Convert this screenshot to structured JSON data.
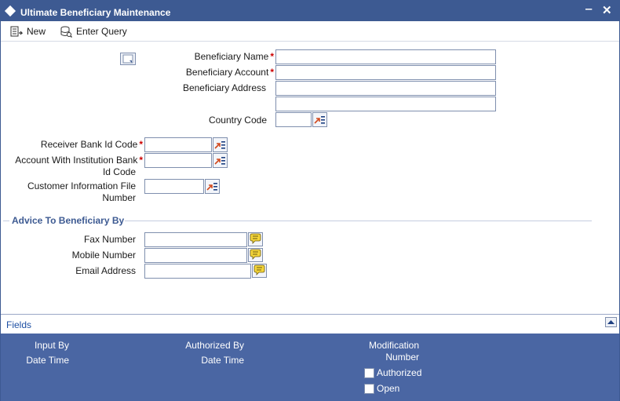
{
  "window": {
    "title": "Ultimate Beneficiary Maintenance",
    "minimize": "‒",
    "close": "✕"
  },
  "toolbar": {
    "new_label": "New",
    "enter_query_label": "Enter Query"
  },
  "form": {
    "beneficiary_name_label": "Beneficiary Name",
    "beneficiary_account_label": "Beneficiary Account",
    "beneficiary_address_label": "Beneficiary Address",
    "country_code_label": "Country Code",
    "receiver_bank_label": "Receiver Bank Id Code",
    "account_with_label_1": "Account With Institution Bank",
    "account_with_label_2": "Id Code",
    "cif_label_1": "Customer Information File",
    "cif_label_2": "Number",
    "required_mark": "*",
    "beneficiary_name": "",
    "beneficiary_account": "",
    "beneficiary_address_1": "",
    "beneficiary_address_2": "",
    "country_code": "",
    "receiver_bank": "",
    "account_with": "",
    "cif": ""
  },
  "advice": {
    "section_title": "Advice To Beneficiary By",
    "fax_label": "Fax Number",
    "mobile_label": "Mobile Number",
    "email_label": "Email Address",
    "fax": "",
    "mobile": "",
    "email": ""
  },
  "fields_bar": {
    "link": "Fields"
  },
  "footer": {
    "input_by": "Input By",
    "date_time_1": "Date Time",
    "authorized_by": "Authorized By",
    "date_time_2": "Date Time",
    "modification_1": "Modification",
    "modification_2": "Number",
    "authorized": "Authorized",
    "open": "Open"
  },
  "colors": {
    "title_bar": "#3d5a92",
    "footer": "#4a66a3",
    "required": "#cc0000",
    "section_title": "#3d5a92"
  }
}
